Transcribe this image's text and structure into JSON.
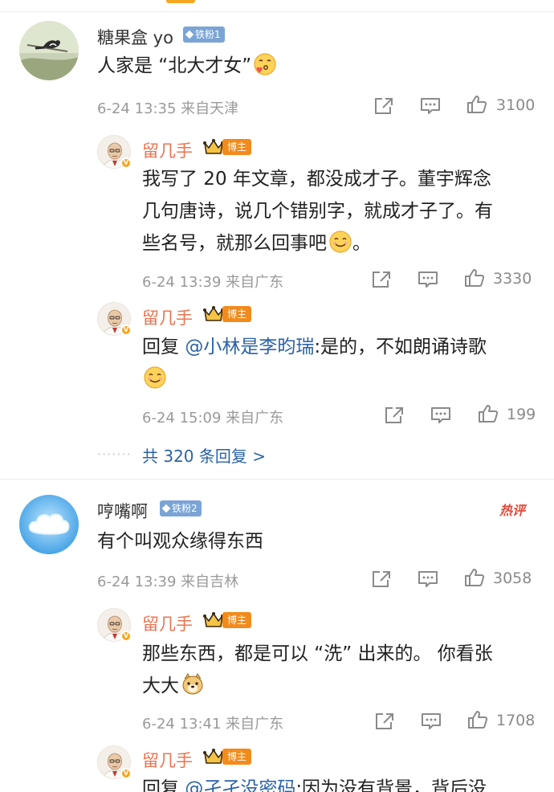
{
  "comments": [
    {
      "user": "糖果盒 yo",
      "fan_badge": "铁粉1",
      "text": "人家是 “北大才女”",
      "time": "6-24 13:35 来自天津",
      "likes": "3100",
      "replies": [
        {
          "user": "留几手",
          "tag": "博主",
          "lines": [
            "我写了 20 年文章，都没成才子。董宇辉念",
            "几句唐诗，说几个错别字，就成才子了。有",
            "些名号，就那么回事吧"
          ],
          "tail": "。",
          "time": "6-24 13:39 来自广东",
          "likes": "3330"
        },
        {
          "user": "留几手",
          "tag": "博主",
          "prefix": "回复 ",
          "mention": "@小林是李昀瑞",
          "rest": ":是的，不如朗诵诗歌",
          "time": "6-24 15:09 来自广东",
          "likes": "199"
        }
      ],
      "more_dots": "·······",
      "more_label": "共 320 条回复 >"
    },
    {
      "user": "哼嘴啊",
      "fan_badge": "铁粉2",
      "hot_label": "热评",
      "text": "有个叫观众缘得东西",
      "time": "6-24 13:39 来自吉林",
      "likes": "3058",
      "replies": [
        {
          "user": "留几手",
          "tag": "博主",
          "lines": [
            "那些东西，都是可以 “洗” 出来的。 你看张",
            "大大"
          ],
          "time": "6-24 13:41 来自广东",
          "likes": "1708"
        },
        {
          "user": "留几手",
          "tag": "博主",
          "prefix": "回复 ",
          "mention": "@孑孑没密码",
          "rest": ":因为没有背景，背后没"
        }
      ]
    }
  ],
  "icons": [
    "share-icon",
    "comment-icon",
    "like-icon"
  ],
  "colors": {
    "accent": "#eb7350",
    "link": "#2b62a8",
    "meta": "#9a9a9a",
    "badge": "#7aa4d6"
  }
}
